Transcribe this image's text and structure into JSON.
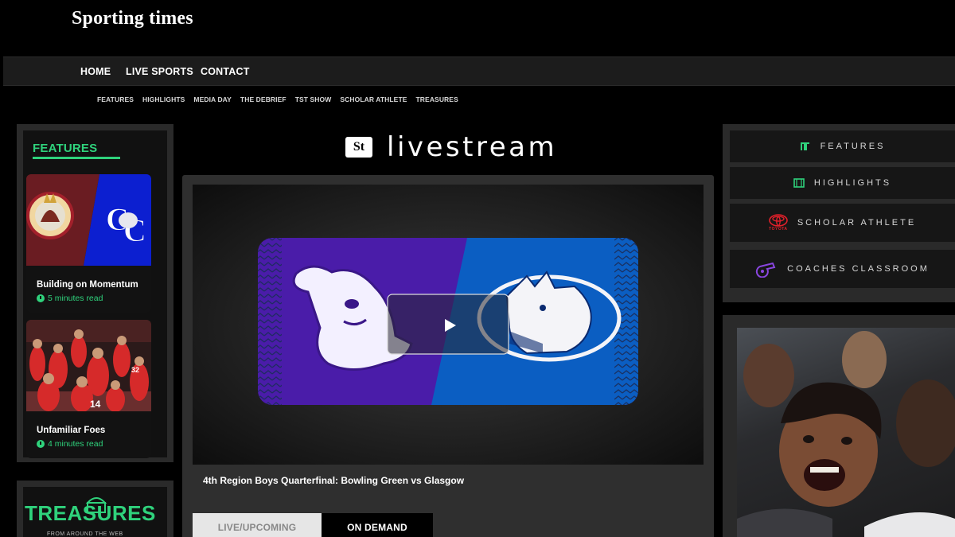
{
  "brand": {
    "name": "Sporting times"
  },
  "main_nav": [
    "HOME",
    "LIVE SPORTS",
    "CONTACT"
  ],
  "sub_nav": [
    "FEATURES",
    "HIGHLIGHTS",
    "MEDIA DAY",
    "THE DEBRIEF",
    "TST SHOW",
    "SCHOLAR ATHLETE",
    "TREASURES"
  ],
  "features": {
    "title": "FEATURES",
    "cards": [
      {
        "title": "Building on Momentum",
        "read_time": "5 minutes read"
      },
      {
        "title": "Unfamiliar Foes",
        "read_time": "4 minutes read"
      }
    ]
  },
  "treasures": {
    "word": "TREASURES",
    "subtitle": "FROM AROUND THE WEB",
    "badge": "St"
  },
  "livestream": {
    "logo": "St",
    "word": "livestream"
  },
  "video": {
    "caption": "4th Region Boys Quarterfinal: Bowling Green vs Glasgow"
  },
  "tabs": {
    "live": "LIVE/UPCOMING",
    "demand": "ON DEMAND"
  },
  "right_menu": [
    {
      "label": "FEATURES",
      "icon": "features-icon"
    },
    {
      "label": "HIGHLIGHTS",
      "icon": "film-icon"
    },
    {
      "label": "SCHOLAR ATHLETE",
      "icon": "toyota-logo-icon",
      "sponsor": "TOYOTA"
    },
    {
      "label": "COACHES CLASSROOM",
      "icon": "whistle-icon"
    }
  ],
  "colors": {
    "accent": "#2fd27c",
    "purple": "#4b19a8",
    "blue": "#0a5bbf"
  }
}
